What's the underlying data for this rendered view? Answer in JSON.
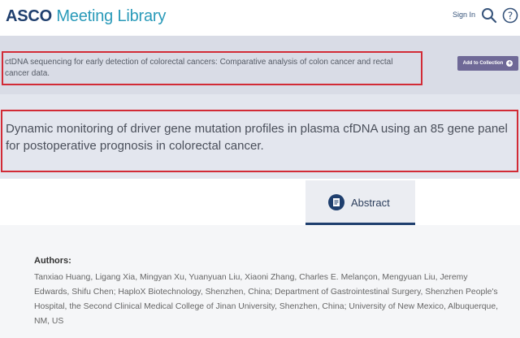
{
  "header": {
    "logo_primary": "ASCO",
    "logo_secondary": "Meeting Library",
    "sign_in": "Sign In",
    "icons": [
      "search-icon",
      "help-icon"
    ],
    "colors": {
      "navy": "#1f3f6e",
      "teal": "#2a9ab9"
    }
  },
  "session": {
    "title": "ctDNA sequencing for early detection of colorectal cancers: Comparative analysis of colon cancer and rectal cancer data.",
    "add_button": "Add to Collection"
  },
  "abstract": {
    "title": "Dynamic monitoring of driver gene mutation profiles in plasma cfDNA using an 85 gene panel for postoperative prognosis in colorectal cancer."
  },
  "tabs": [
    {
      "label": "Abstract",
      "icon": "document-icon",
      "active": true
    }
  ],
  "authors": {
    "heading": "Authors:",
    "text": "Tanxiao Huang, Ligang Xia, Mingyan Xu, Yuanyuan Liu, Xiaoni Zhang, Charles E. Melançon, Mengyuan Liu, Jeremy Edwards, Shifu Chen; HaploX Biotechnology, Shenzhen, China; Department of Gastrointestinal Surgery, Shenzhen People's Hospital, the Second Clinical Medical College of Jinan University, Shenzhen, China; University of New Mexico, Albuquerque, NM, US"
  },
  "highlight_color": "#d22b36"
}
